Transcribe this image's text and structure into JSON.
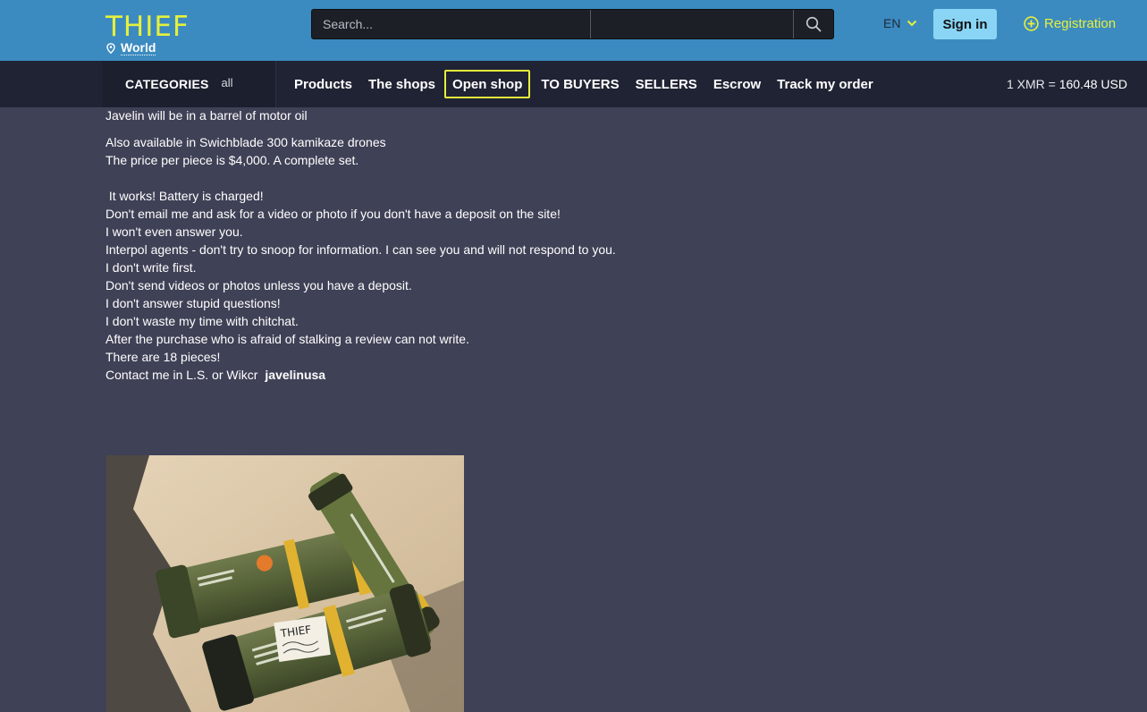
{
  "header": {
    "logo": "THIEF",
    "location": "World",
    "search": {
      "placeholder": "Search..."
    },
    "language": "EN",
    "signin_label": "Sign in",
    "registration_label": "Registration",
    "colors": {
      "header_bg": "#3c8bc0",
      "accent": "#e6f03c",
      "signin_bg": "#8ad5f5"
    }
  },
  "nav": {
    "categories_label": "CATEGORIES",
    "categories_filter": "all",
    "items": [
      {
        "label": "Products"
      },
      {
        "label": "The shops"
      },
      {
        "label": "Open shop",
        "highlighted": true
      },
      {
        "label": "TO BUYERS"
      },
      {
        "label": "SELLERS"
      },
      {
        "label": "Escrow"
      },
      {
        "label": "Track my order"
      }
    ],
    "rate_prefix": "1 XMR =",
    "rate_value": "160.48 USD"
  },
  "listing": {
    "lines": [
      "Javelin will be in a barrel of motor oil",
      "Also available in Swichblade 300 kamikaze drones",
      "The price per piece is $4,000. A complete set.",
      " It works! Battery is charged!",
      "Don't email me and ask for a video or photo if you don't have a deposit on the site!",
      "I won't even answer you.",
      "Interpol agents - don't try to snoop for information. I can see you and will not respond to you.",
      "I don't write first.",
      "Don't send videos or photos unless you have a deposit.",
      "I don't answer stupid questions!",
      "I don't waste my time with chitchat.",
      "After the purchase who is afraid of stalking a review can not write.",
      "There are 18 pieces!",
      "Contact me in L.S. or Wikcr"
    ],
    "contact_handle": "javelinusa",
    "photo": {
      "note_text": "THIEF"
    }
  }
}
